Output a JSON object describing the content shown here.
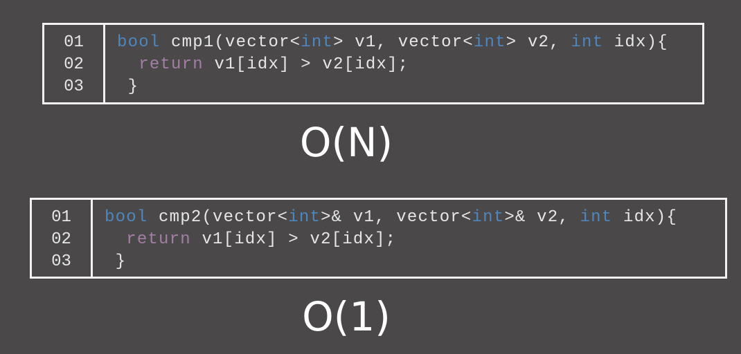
{
  "snippets": [
    {
      "line_numbers": [
        "01",
        "02",
        "03"
      ],
      "line1": {
        "kw1": "bool",
        "t1": " cmp1(vector<",
        "kw2": "int",
        "t2": "> v1, vector<",
        "kw3": "int",
        "t3": "> v2, ",
        "kw4": "int",
        "t4": " idx){"
      },
      "line2": {
        "indent": "  ",
        "kw": "return",
        "t": " v1[idx] > v2[idx];"
      },
      "line3": " }",
      "complexity": "O(N)"
    },
    {
      "line_numbers": [
        "01",
        "02",
        "03"
      ],
      "line1": {
        "kw1": "bool",
        "t1": " cmp2(vector<",
        "kw2": "int",
        "t2": ">& v1, vector<",
        "kw3": "int",
        "t3": ">& v2, ",
        "kw4": "int",
        "t4": " idx){"
      },
      "line2": {
        "indent": "  ",
        "kw": "return",
        "t": " v1[idx] > v2[idx];"
      },
      "line3": " }",
      "complexity": "O(1)"
    }
  ],
  "colors": {
    "background": "#4a4849",
    "keyword": "#4f86bd",
    "return_keyword": "#a27fa3",
    "text": "#e6e6e6",
    "border": "#f2f2f2"
  }
}
